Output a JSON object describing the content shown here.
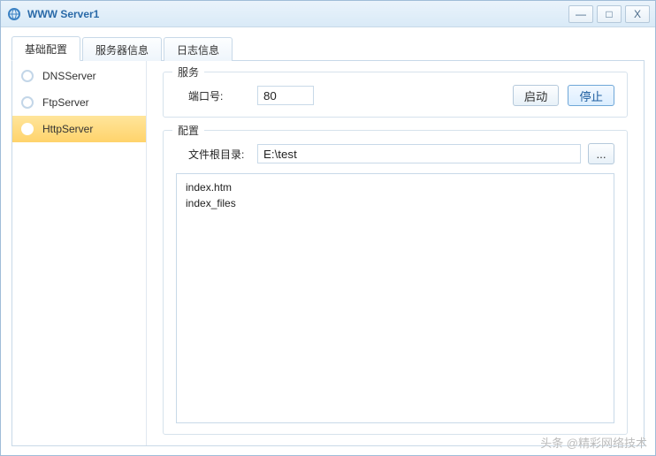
{
  "window": {
    "title": "WWW Server1",
    "buttons": {
      "min": "—",
      "max": "□",
      "close": "X"
    }
  },
  "tabs": [
    {
      "label": "基础配置",
      "active": true
    },
    {
      "label": "服务器信息",
      "active": false
    },
    {
      "label": "日志信息",
      "active": false
    }
  ],
  "sidebar": [
    {
      "label": "DNSServer",
      "selected": false
    },
    {
      "label": "FtpServer",
      "selected": false
    },
    {
      "label": "HttpServer",
      "selected": true
    }
  ],
  "service": {
    "legend": "服务",
    "port_label": "端口号:",
    "port_value": "80",
    "start_label": "启动",
    "stop_label": "停止"
  },
  "config": {
    "legend": "配置",
    "root_label": "文件根目录:",
    "root_value": "E:\\test",
    "browse_label": "...",
    "files": [
      "index.htm",
      "index_files"
    ]
  },
  "watermark": "头条 @精彩网络技术"
}
